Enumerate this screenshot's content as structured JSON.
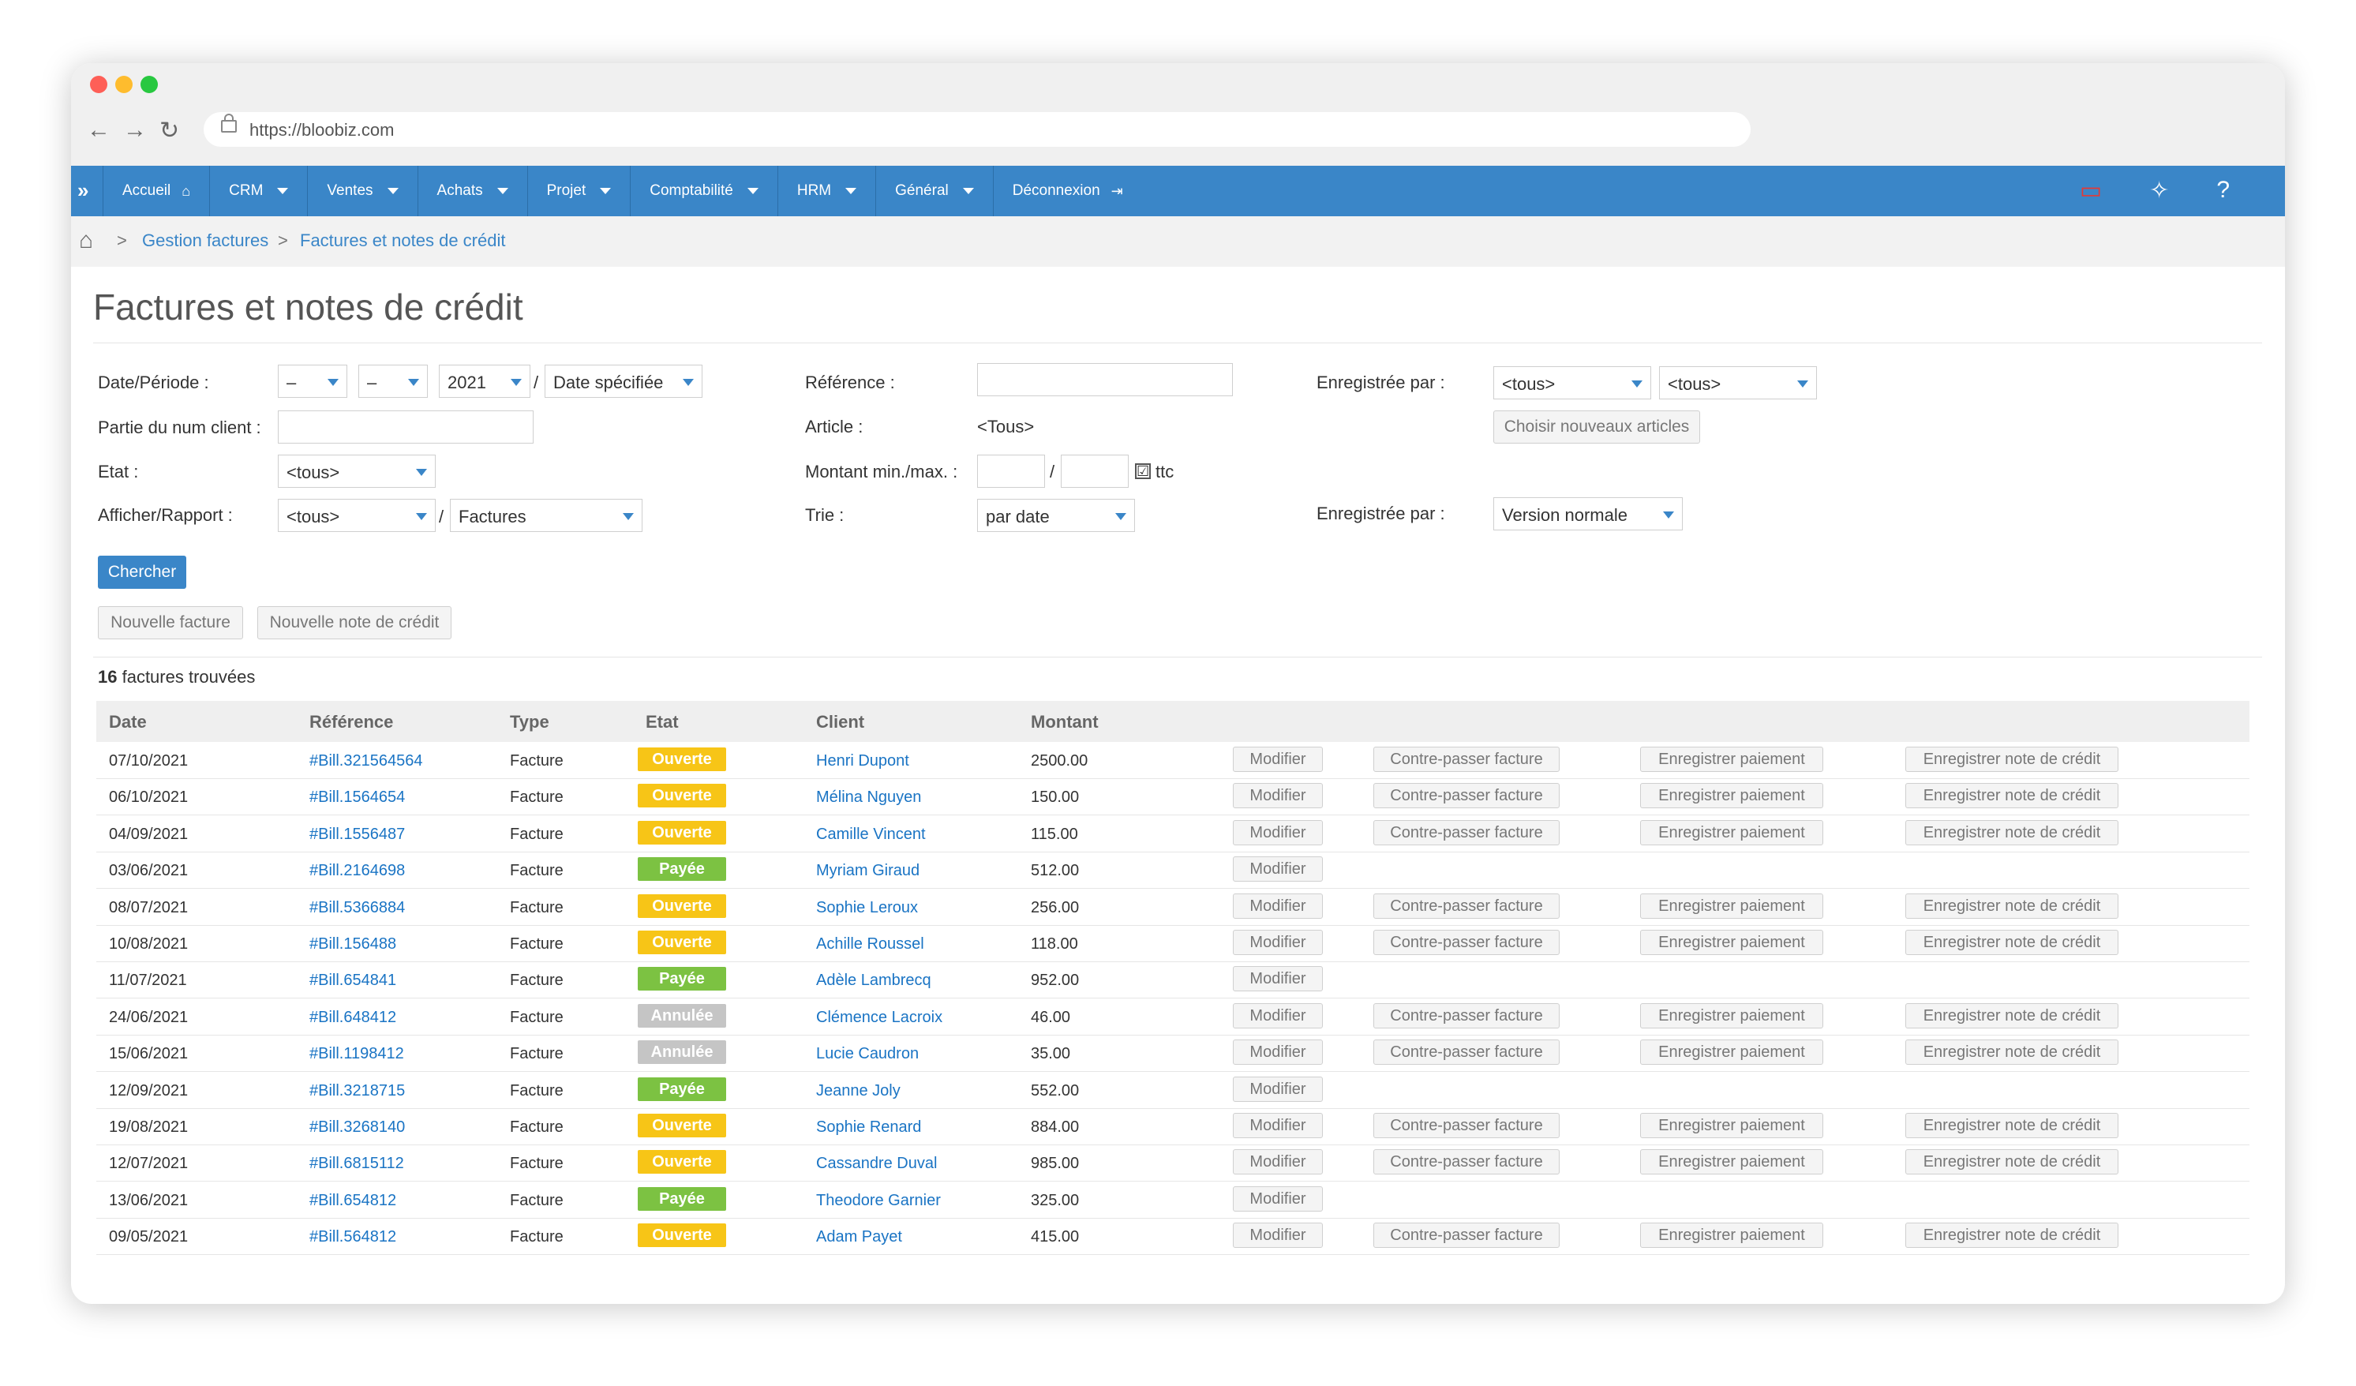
{
  "browser": {
    "url": "https://bloobiz.com"
  },
  "nav": {
    "items": [
      {
        "label": "Accueil",
        "kind": "home"
      },
      {
        "label": "CRM",
        "kind": "caret"
      },
      {
        "label": "Ventes",
        "kind": "caret"
      },
      {
        "label": "Achats",
        "kind": "caret"
      },
      {
        "label": "Projet",
        "kind": "caret"
      },
      {
        "label": "Comptabilité",
        "kind": "caret"
      },
      {
        "label": "HRM",
        "kind": "caret"
      },
      {
        "label": "Général",
        "kind": "caret"
      },
      {
        "label": "Déconnexion",
        "kind": "logout"
      }
    ],
    "help": "?"
  },
  "breadcrumb": {
    "items": [
      "Gestion factures",
      "Factures et notes de crédit"
    ]
  },
  "page": {
    "title": "Factures et notes de crédit"
  },
  "filters": {
    "date_label": "Date/Période :",
    "date_day": "–",
    "date_month": "–",
    "date_year": "2021",
    "date_mode": "Date spécifiée",
    "client_label": "Partie du num client :",
    "etat_label": "Etat :",
    "etat_value": "<tous>",
    "afficher_label": "Afficher/Rapport :",
    "afficher_value": "<tous>",
    "rapport_value": "Factures",
    "reference_label": "Référence :",
    "article_label": "Article :",
    "article_value": "<Tous>",
    "montant_label": "Montant min./max. :",
    "ttc_label": "ttc",
    "ttc_checked": "☑",
    "trie_label": "Trie :",
    "trie_value": "par date",
    "enreg_label": "Enregistrée par :",
    "enreg_value1": "<tous>",
    "enreg_value2": "<tous>",
    "choose_articles": "Choisir nouveaux articles",
    "enreg2_label": "Enregistrée par :",
    "version_value": "Version normale"
  },
  "actions": {
    "search": "Chercher",
    "new_invoice": "Nouvelle facture",
    "new_credit": "Nouvelle note de crédit"
  },
  "results": {
    "count": "16",
    "count_text": " factures trouvées"
  },
  "table": {
    "headers": [
      "Date",
      "Référence",
      "Type",
      "Etat",
      "Client",
      "Montant"
    ],
    "buttons": {
      "modify": "Modifier",
      "reverse": "Contre-passer facture",
      "payment": "Enregistrer paiement",
      "credit": "Enregistrer note de crédit"
    },
    "rows": [
      {
        "date": "07/10/2021",
        "ref": "#Bill.321564564",
        "type": "Facture",
        "status": "Ouverte",
        "client": "Henri Dupont",
        "amount": "2500.00"
      },
      {
        "date": "06/10/2021",
        "ref": "#Bill.1564654",
        "type": "Facture",
        "status": "Ouverte",
        "client": "Mélina Nguyen",
        "amount": "150.00"
      },
      {
        "date": "04/09/2021",
        "ref": "#Bill.1556487",
        "type": "Facture",
        "status": "Ouverte",
        "client": "Camille Vincent",
        "amount": "115.00"
      },
      {
        "date": "03/06/2021",
        "ref": "#Bill.2164698",
        "type": "Facture",
        "status": "Payée",
        "client": "Myriam Giraud",
        "amount": "512.00"
      },
      {
        "date": "08/07/2021",
        "ref": "#Bill.5366884",
        "type": "Facture",
        "status": "Ouverte",
        "client": "Sophie Leroux",
        "amount": "256.00"
      },
      {
        "date": "10/08/2021",
        "ref": "#Bill.156488",
        "type": "Facture",
        "status": "Ouverte",
        "client": "Achille Roussel",
        "amount": "118.00"
      },
      {
        "date": "11/07/2021",
        "ref": "#Bill.654841",
        "type": "Facture",
        "status": "Payée",
        "client": "Adèle Lambrecq",
        "amount": "952.00"
      },
      {
        "date": "24/06/2021",
        "ref": "#Bill.648412",
        "type": "Facture",
        "status": "Annulée",
        "client": "Clémence Lacroix",
        "amount": "46.00"
      },
      {
        "date": "15/06/2021",
        "ref": "#Bill.1198412",
        "type": "Facture",
        "status": "Annulée",
        "client": "Lucie Caudron",
        "amount": "35.00"
      },
      {
        "date": "12/09/2021",
        "ref": "#Bill.3218715",
        "type": "Facture",
        "status": "Payée",
        "client": "Jeanne Joly",
        "amount": "552.00"
      },
      {
        "date": "19/08/2021",
        "ref": "#Bill.3268140",
        "type": "Facture",
        "status": "Ouverte",
        "client": "Sophie Renard",
        "amount": "884.00"
      },
      {
        "date": "12/07/2021",
        "ref": "#Bill.6815112",
        "type": "Facture",
        "status": "Ouverte",
        "client": "Cassandre Duval",
        "amount": "985.00"
      },
      {
        "date": "13/06/2021",
        "ref": "#Bill.654812",
        "type": "Facture",
        "status": "Payée",
        "client": "Theodore Garnier",
        "amount": "325.00"
      },
      {
        "date": "09/05/2021",
        "ref": "#Bill.564812",
        "type": "Facture",
        "status": "Ouverte",
        "client": "Adam Payet",
        "amount": "415.00"
      }
    ]
  },
  "colors": {
    "nav": "#3a86c8",
    "open": "#f7c517",
    "paid": "#7cc242",
    "cancelled": "#c5c5c5",
    "link": "#1a74c4"
  }
}
